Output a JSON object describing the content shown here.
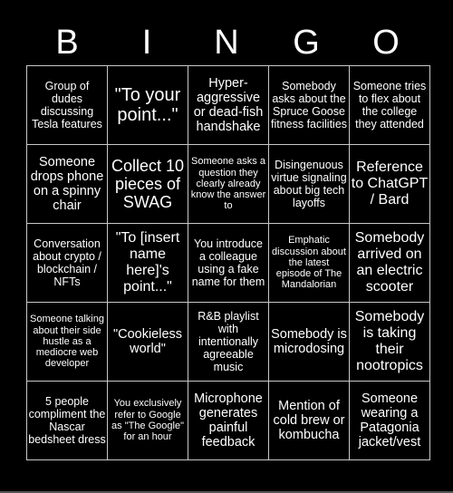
{
  "header": {
    "letters": [
      "B",
      "I",
      "N",
      "G",
      "O"
    ]
  },
  "card": {
    "rows": [
      [
        "Group of dudes discussing Tesla features",
        "\"To your point...\"",
        "Hyper-aggressive or dead-fish handshake",
        "Somebody asks about the Spruce Goose fitness facilities",
        "Someone tries to flex about the college they attended"
      ],
      [
        "Someone drops phone on a spinny chair",
        "Collect 10 pieces of SWAG",
        "Someone asks a question they clearly already know the answer to",
        "Disingenuous virtue signaling about big tech layoffs",
        "Reference to ChatGPT / Bard"
      ],
      [
        "Conversation about crypto / blockchain / NFTs",
        "\"To [insert name here]'s point...\"",
        "You introduce a colleague using a fake name for them",
        "Emphatic discussion about the latest episode of The Mandalorian",
        "Somebody arrived on an electric scooter"
      ],
      [
        "Someone talking about their side hustle as a mediocre web developer",
        "\"Cookieless world\"",
        "R&B playlist with intentionally agreeable music",
        "Somebody is microdosing",
        "Somebody is taking their nootropics"
      ],
      [
        "5 people compliment the Nascar bedsheet dress",
        "You exclusively refer to Google as \"The Google\" for an hour",
        "Microphone generates painful feedback",
        "Mention of cold brew or kombucha",
        "Someone wearing a Patagonia jacket/vest"
      ]
    ]
  }
}
